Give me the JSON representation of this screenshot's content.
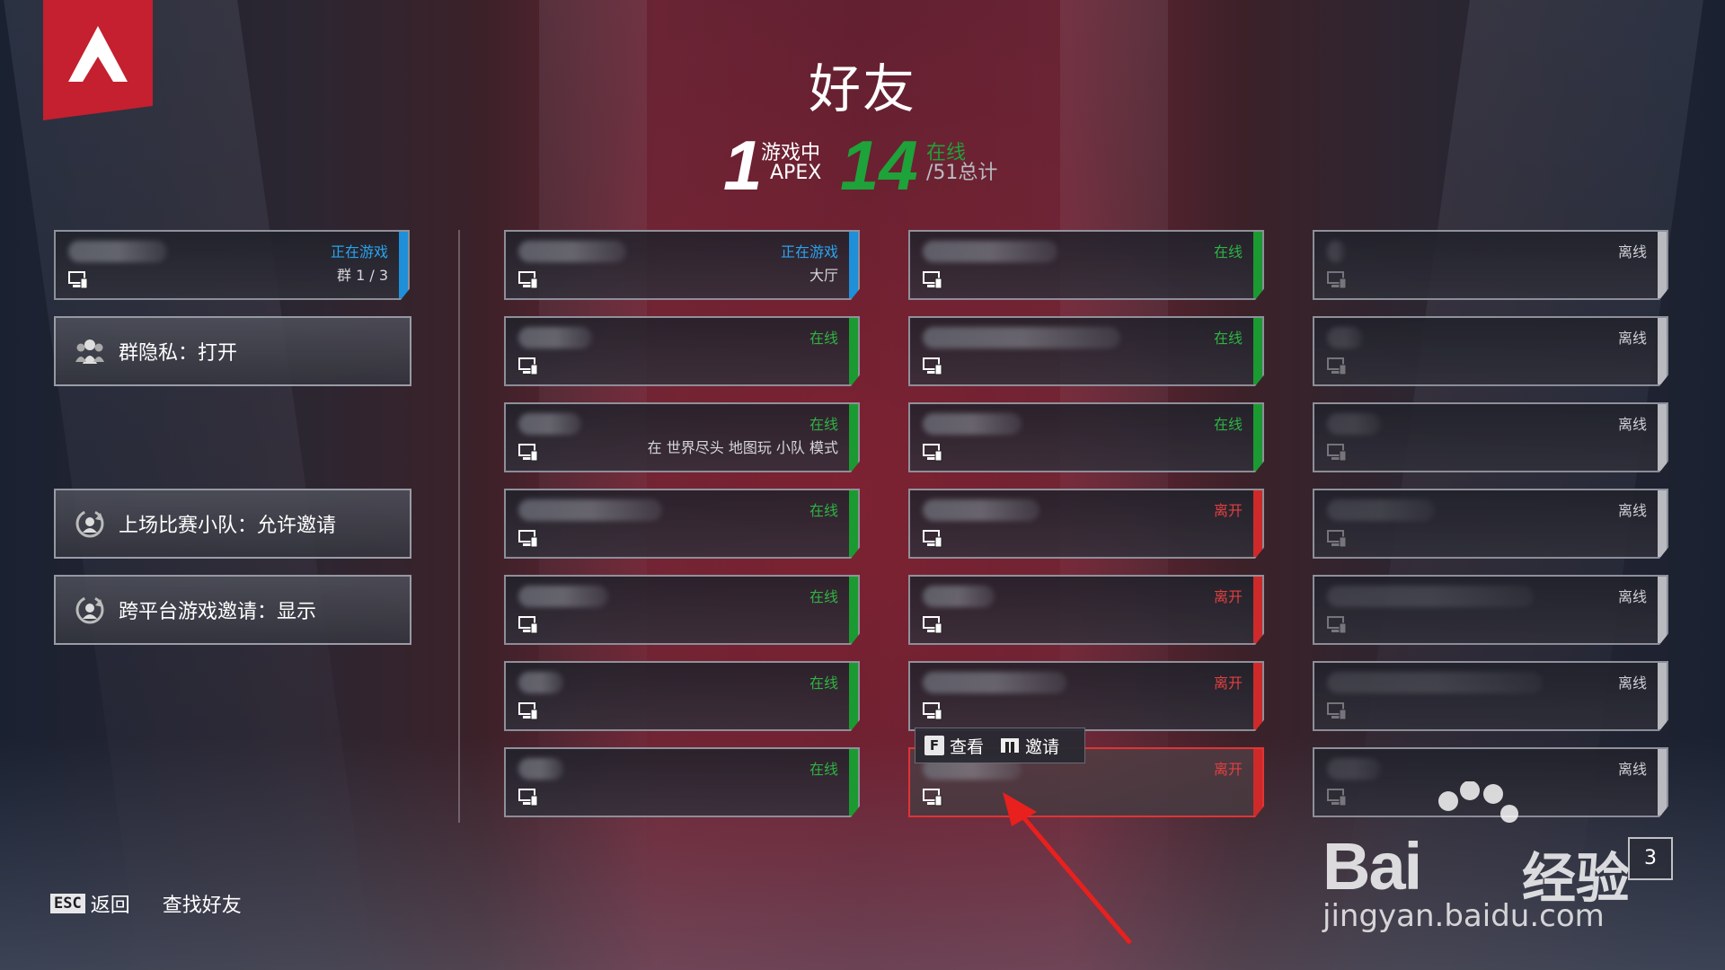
{
  "page": {
    "title": "好友"
  },
  "stats": {
    "in_game_count": "1",
    "in_game_label": "游戏中",
    "in_game_sub": "APEX",
    "online_count": "14",
    "online_label": "在线",
    "total_label": "/51总计"
  },
  "colors": {
    "blue": "#1e8fd8",
    "green": "#1c9a32",
    "red": "#cf2a2a",
    "offline": "#b8bac0",
    "logo": "#c4202f"
  },
  "party_card": {
    "status": "正在游戏",
    "sub": "群 1 / 3"
  },
  "settings": [
    {
      "label": "群隐私：打开",
      "icon": "party-icon"
    },
    {
      "label": "上场比赛小队：允许邀请",
      "icon": "refresh-icon"
    },
    {
      "label": "跨平台游戏邀请：显示",
      "icon": "refresh-icon"
    }
  ],
  "friends_col1": [
    {
      "status": "正在游戏",
      "sub": "大厅",
      "state": "blue"
    },
    {
      "status": "在线",
      "sub": "",
      "state": "green"
    },
    {
      "status": "在线",
      "sub": "在 世界尽头 地图玩 小队 模式",
      "state": "green"
    },
    {
      "status": "在线",
      "sub": "",
      "state": "green"
    },
    {
      "status": "在线",
      "sub": "",
      "state": "green"
    },
    {
      "status": "在线",
      "sub": "",
      "state": "green"
    },
    {
      "status": "在线",
      "sub": "",
      "state": "green"
    }
  ],
  "friends_col2": [
    {
      "status": "在线",
      "state": "green"
    },
    {
      "status": "在线",
      "state": "green"
    },
    {
      "status": "在线",
      "state": "green"
    },
    {
      "status": "离开",
      "state": "red"
    },
    {
      "status": "离开",
      "state": "red"
    },
    {
      "status": "离开",
      "state": "red"
    },
    {
      "status": "离开",
      "state": "red",
      "selected": true
    }
  ],
  "friends_col3": [
    {
      "status": "离线",
      "state": "grey"
    },
    {
      "status": "离线",
      "state": "grey"
    },
    {
      "status": "离线",
      "state": "grey"
    },
    {
      "status": "离线",
      "state": "grey"
    },
    {
      "status": "离线",
      "state": "grey"
    },
    {
      "status": "离线",
      "state": "grey"
    },
    {
      "status": "离线",
      "state": "grey"
    }
  ],
  "tooltip": {
    "view_key": "F",
    "view_label": "查看",
    "invite_label": "邀请"
  },
  "footer": {
    "esc_key": "ESC",
    "back_label": "返回",
    "find_label": "查找好友"
  },
  "watermark": {
    "brand": "Bai",
    "brand_cn": "经验",
    "url": "jingyan.baidu.com"
  },
  "page_indicator": "3"
}
